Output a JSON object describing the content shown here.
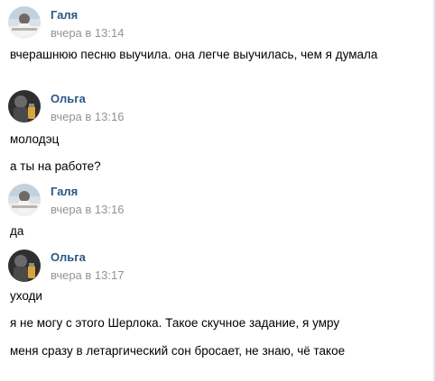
{
  "messages": [
    {
      "author": "Галя",
      "time": "вчера в 13:14",
      "lines": [
        "вчерашнюю песню выучила. она легче выучилась, чем я думала"
      ]
    },
    {
      "author": "Ольга",
      "time": "вчера в 13:16",
      "lines": [
        "молодэц",
        "а ты на работе?"
      ]
    },
    {
      "author": "Галя",
      "time": "вчера в 13:16",
      "lines": [
        "да"
      ]
    },
    {
      "author": "Ольга",
      "time": "вчера в 13:17",
      "lines": [
        "уходи",
        "я не могу с этого Шерлока. Такое скучное задание, я умру",
        "меня сразу в летаргический сон бросает, не знаю, чё такое"
      ]
    }
  ],
  "colors": {
    "author": "#2a5885",
    "time": "#939393",
    "text": "#000000",
    "background": "#ffffff"
  },
  "icons": {
    "avatar_galya": "avatar-galya-icon",
    "avatar_olga": "avatar-olga-icon"
  }
}
